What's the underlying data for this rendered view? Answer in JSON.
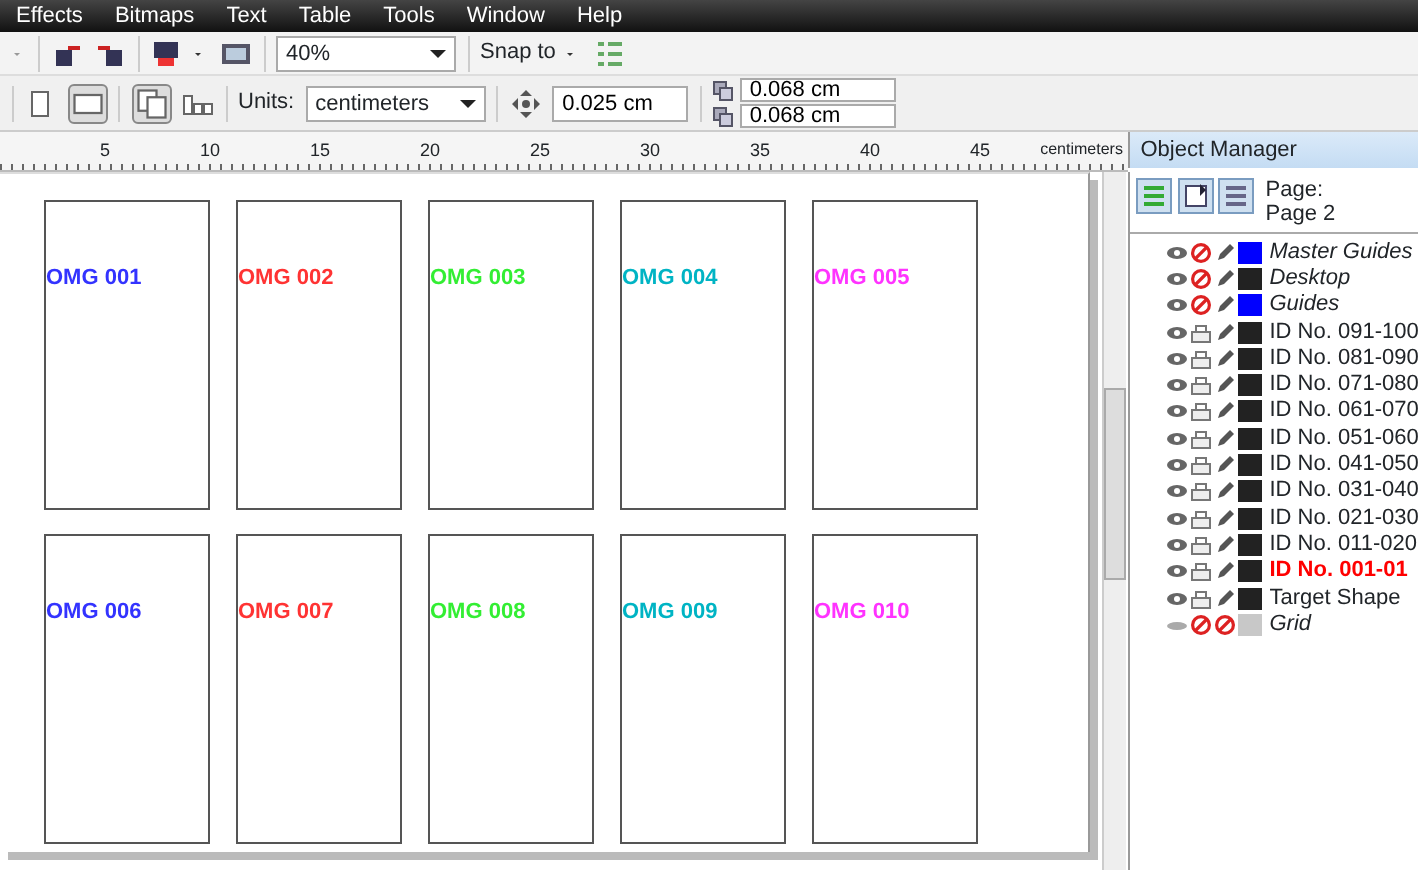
{
  "menu": [
    "Effects",
    "Bitmaps",
    "Text",
    "Table",
    "Tools",
    "Window",
    "Help"
  ],
  "toolbar": {
    "zoom": "40%",
    "snap": "Snap to"
  },
  "property_bar": {
    "units_label": "Units:",
    "units": "centimeters",
    "nudge": "0.025 cm",
    "offset_x": "0.068 cm",
    "offset_y": "0.068 cm"
  },
  "ruler": {
    "labels": [
      "5",
      "10",
      "15",
      "20",
      "25",
      "30",
      "35",
      "40",
      "45"
    ],
    "unit": "centimeters"
  },
  "cards": [
    {
      "label": "OMG 001",
      "color": "#3333ff"
    },
    {
      "label": "OMG 002",
      "color": "#ff3333"
    },
    {
      "label": "OMG 003",
      "color": "#33ee33"
    },
    {
      "label": "OMG 004",
      "color": "#00b4c4"
    },
    {
      "label": "OMG 005",
      "color": "#ff33ff"
    },
    {
      "label": "OMG 006",
      "color": "#3333ff"
    },
    {
      "label": "OMG 007",
      "color": "#ff3333"
    },
    {
      "label": "OMG 008",
      "color": "#33ee33"
    },
    {
      "label": "OMG 009",
      "color": "#00b4c4"
    },
    {
      "label": "OMG 010",
      "color": "#ff33ff"
    }
  ],
  "object_manager": {
    "title": "Object Manager",
    "page_label": "Page:",
    "page_name": "Page 2",
    "layers": [
      {
        "name": "Master Guides",
        "kind": "master",
        "visible": true,
        "printable": false,
        "editable": true,
        "color": "#0000ff",
        "selected": false
      },
      {
        "name": "Desktop",
        "kind": "master",
        "visible": true,
        "printable": false,
        "editable": true,
        "color": "#222222",
        "selected": false
      },
      {
        "name": "Guides",
        "kind": "master",
        "visible": true,
        "printable": false,
        "editable": true,
        "color": "#0000ff",
        "selected": false
      },
      {
        "name": "ID No. 091-100",
        "kind": "layer",
        "visible": true,
        "printable": true,
        "editable": true,
        "color": "#222222",
        "selected": false
      },
      {
        "name": "ID No. 081-090",
        "kind": "layer",
        "visible": true,
        "printable": true,
        "editable": true,
        "color": "#222222",
        "selected": false
      },
      {
        "name": "ID No. 071-080",
        "kind": "layer",
        "visible": true,
        "printable": true,
        "editable": true,
        "color": "#222222",
        "selected": false
      },
      {
        "name": "ID No. 061-070",
        "kind": "layer",
        "visible": true,
        "printable": true,
        "editable": true,
        "color": "#222222",
        "selected": false
      },
      {
        "name": "ID No. 051-060",
        "kind": "layer",
        "visible": true,
        "printable": true,
        "editable": true,
        "color": "#222222",
        "selected": false
      },
      {
        "name": "ID No. 041-050",
        "kind": "layer",
        "visible": true,
        "printable": true,
        "editable": true,
        "color": "#222222",
        "selected": false
      },
      {
        "name": "ID No. 031-040",
        "kind": "layer",
        "visible": true,
        "printable": true,
        "editable": true,
        "color": "#222222",
        "selected": false
      },
      {
        "name": "ID No. 021-030",
        "kind": "layer",
        "visible": true,
        "printable": true,
        "editable": true,
        "color": "#222222",
        "selected": false
      },
      {
        "name": "ID No. 011-020",
        "kind": "layer",
        "visible": true,
        "printable": true,
        "editable": true,
        "color": "#222222",
        "selected": false
      },
      {
        "name": "ID No. 001-01",
        "kind": "layer",
        "visible": true,
        "printable": true,
        "editable": true,
        "color": "#222222",
        "selected": true
      },
      {
        "name": "Target Shape",
        "kind": "layer",
        "visible": true,
        "printable": true,
        "editable": true,
        "color": "#222222",
        "selected": false
      },
      {
        "name": "Grid",
        "kind": "master",
        "visible": false,
        "printable": false,
        "editable": false,
        "color": "#c8c8c8",
        "selected": false
      }
    ]
  }
}
